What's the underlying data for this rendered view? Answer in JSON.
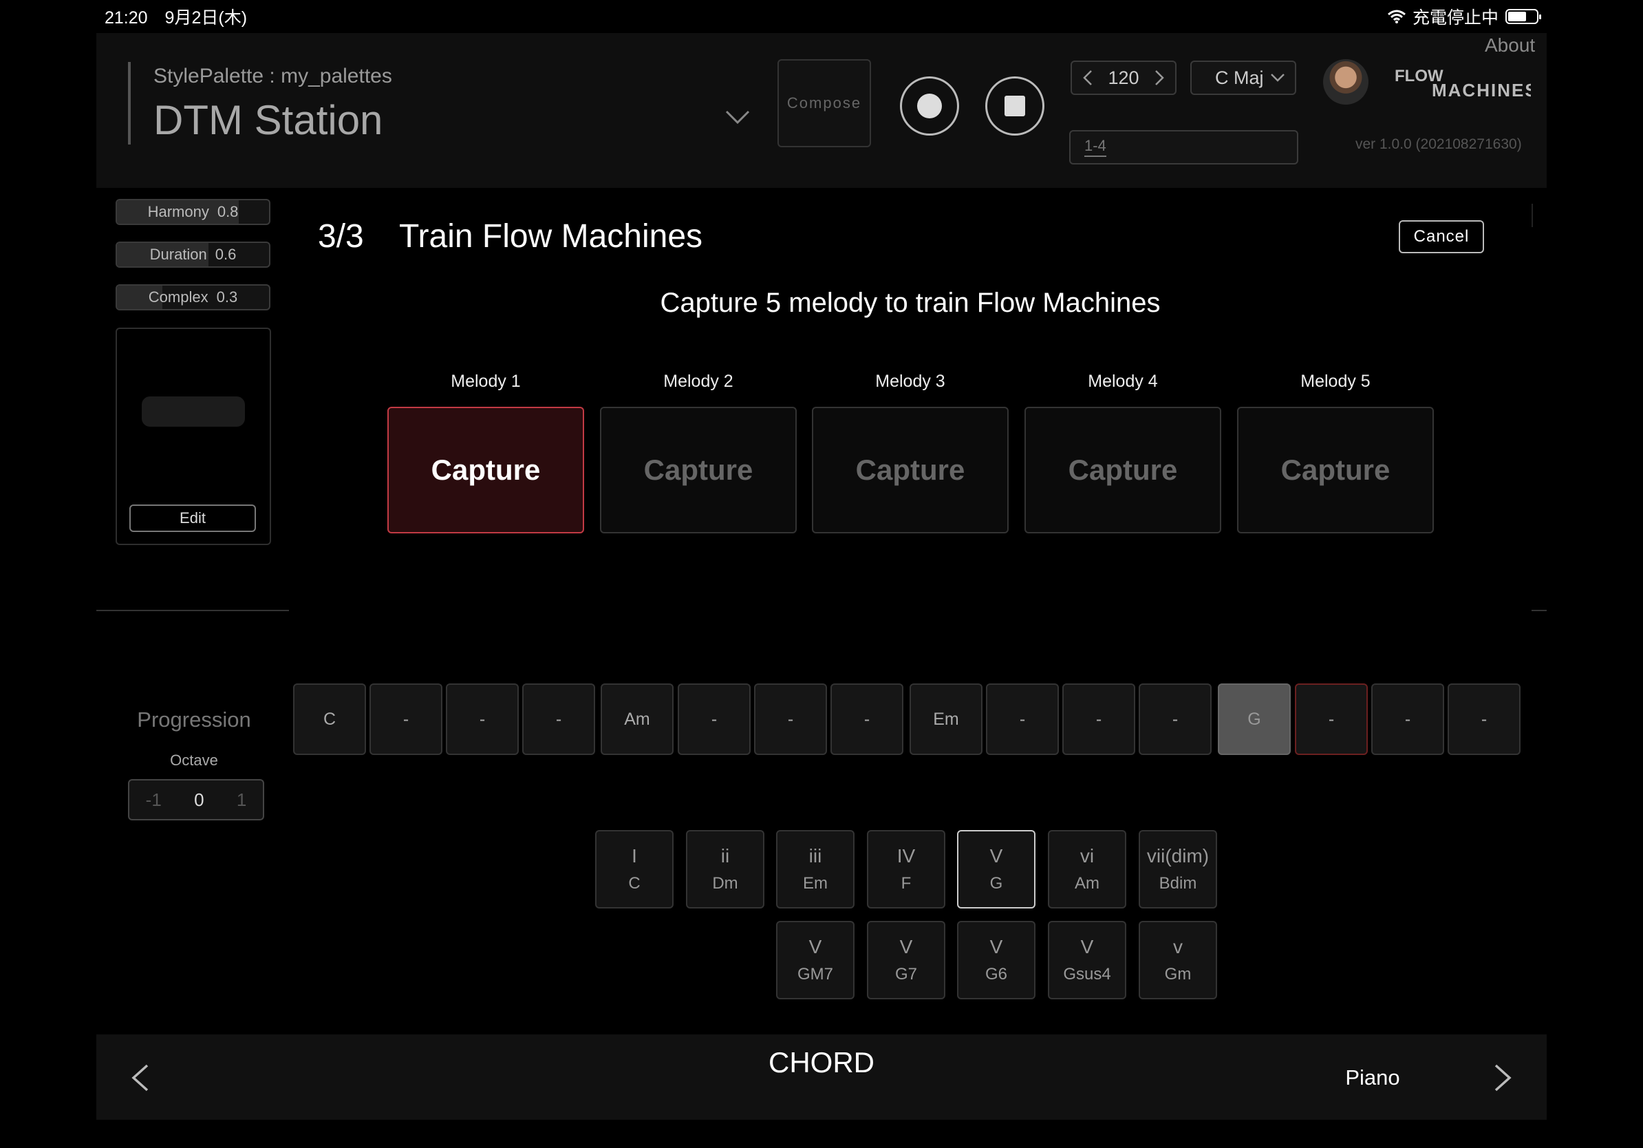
{
  "status_bar": {
    "time_date": "21:20　9月2日(木)",
    "charging_text": "充電停止中"
  },
  "header": {
    "palette_label": "StylePalette : my_palettes",
    "station_title": "DTM Station",
    "compose_label": "Compose",
    "tempo": "120",
    "key": "C Maj",
    "range": "1-4",
    "about": "About",
    "version": "ver 1.0.0 (202108271630)",
    "logo_line1": "FLOW",
    "logo_line2": "MACHINES"
  },
  "sliders": [
    {
      "label": "Harmony",
      "value": "0.8",
      "level": 0.8
    },
    {
      "label": "Duration",
      "value": "0.6",
      "level": 0.6
    },
    {
      "label": "Complex",
      "value": "0.3",
      "level": 0.3
    }
  ],
  "left_panel": {
    "edit_label": "Edit"
  },
  "training": {
    "step": "3/3",
    "title": "Train Flow Machines",
    "cancel_label": "Cancel",
    "instructions": "Capture 5 melody to train Flow Machines",
    "melodies": [
      {
        "label": "Melody 1",
        "button": "Capture",
        "active": true
      },
      {
        "label": "Melody 2",
        "button": "Capture",
        "active": false
      },
      {
        "label": "Melody 3",
        "button": "Capture",
        "active": false
      },
      {
        "label": "Melody 4",
        "button": "Capture",
        "active": false
      },
      {
        "label": "Melody 5",
        "button": "Capture",
        "active": false
      }
    ]
  },
  "progression": {
    "label": "Progression",
    "octave_label": "Octave",
    "octave_options": [
      "-1",
      "0",
      "1"
    ],
    "octave_selected": "0",
    "cells": [
      "C",
      "-",
      "-",
      "-",
      "Am",
      "-",
      "-",
      "-",
      "Em",
      "-",
      "-",
      "-",
      "G",
      "-",
      "-",
      "-"
    ],
    "highlighted_index": 12,
    "current_index": 13
  },
  "chord_palette": {
    "row1": [
      {
        "numeral": "I",
        "name": "C"
      },
      {
        "numeral": "ii",
        "name": "Dm"
      },
      {
        "numeral": "iii",
        "name": "Em"
      },
      {
        "numeral": "IV",
        "name": "F"
      },
      {
        "numeral": "V",
        "name": "G",
        "selected": true
      },
      {
        "numeral": "vi",
        "name": "Am"
      },
      {
        "numeral": "vii(dim)",
        "name": "Bdim"
      }
    ],
    "row2": [
      {
        "numeral": "V",
        "name": "GM7"
      },
      {
        "numeral": "V",
        "name": "G7"
      },
      {
        "numeral": "V",
        "name": "G6"
      },
      {
        "numeral": "V",
        "name": "Gsus4"
      },
      {
        "numeral": "v",
        "name": "Gm"
      }
    ]
  },
  "bottom_bar": {
    "mode": "CHORD",
    "instrument": "Piano"
  }
}
